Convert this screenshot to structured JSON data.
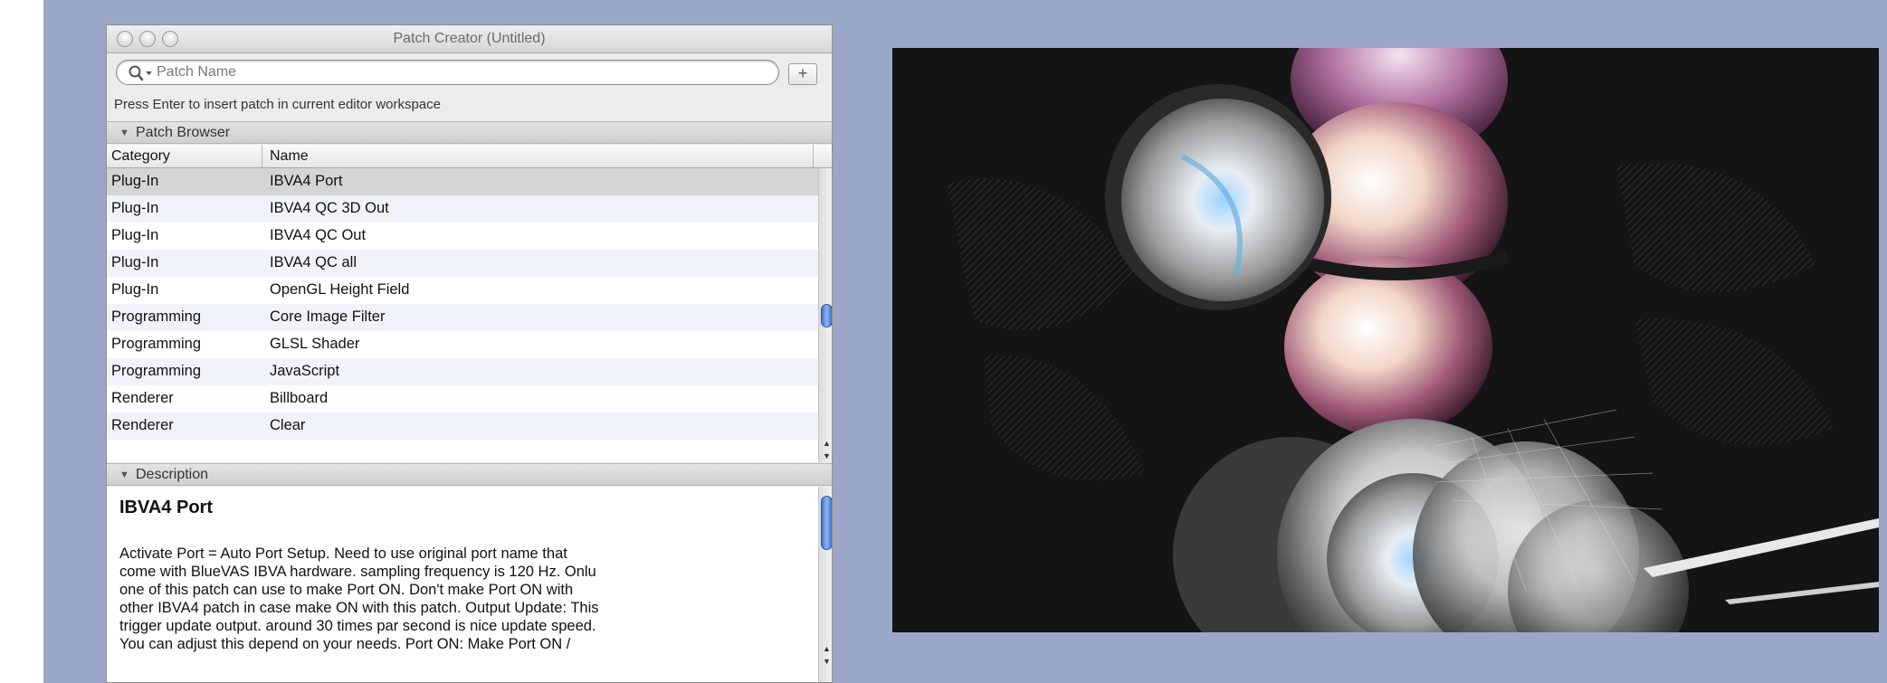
{
  "window": {
    "title": "Patch Creator (Untitled)"
  },
  "search": {
    "placeholder": "Patch Name",
    "value": "",
    "add_label": "+"
  },
  "hint": "Press Enter to insert patch in current editor workspace",
  "patch_browser": {
    "section_label": "Patch Browser",
    "columns": [
      "Category",
      "Name"
    ],
    "selected_index": 0,
    "rows": [
      {
        "category": "Plug-In",
        "name": "IBVA4 Port"
      },
      {
        "category": "Plug-In",
        "name": "IBVA4 QC 3D Out"
      },
      {
        "category": "Plug-In",
        "name": "IBVA4 QC Out"
      },
      {
        "category": "Plug-In",
        "name": "IBVA4 QC all"
      },
      {
        "category": "Plug-In",
        "name": "OpenGL Height Field"
      },
      {
        "category": "Programming",
        "name": "Core Image Filter"
      },
      {
        "category": "Programming",
        "name": "GLSL Shader"
      },
      {
        "category": "Programming",
        "name": "JavaScript"
      },
      {
        "category": "Renderer",
        "name": "Billboard"
      },
      {
        "category": "Renderer",
        "name": "Clear"
      }
    ]
  },
  "description": {
    "section_label": "Description",
    "title": "IBVA4 Port",
    "lines": [
      "Activate Port = Auto Port Setup. Need to use original port name that",
      "come with BlueVAS IBVA hardware. sampling frequency is 120 Hz. Onlu",
      "one of this patch can use to make Port ON. Don't make Port ON with",
      "other IBVA4 patch in case make ON with this patch.  Output Update: This",
      "trigger update output. around 30 times par second is nice update speed.",
      "You can adjust this depend on your needs.  Port ON: Make Port ON /"
    ]
  },
  "colors": {
    "background": "#9aa7c8",
    "selection": "#d5d5d5",
    "scroll_thumb": "#4a7fd4",
    "viewer_background": "#141414"
  },
  "icons": {
    "search": "magnifier-icon",
    "section_toggle": "disclosure-triangle-icon"
  }
}
